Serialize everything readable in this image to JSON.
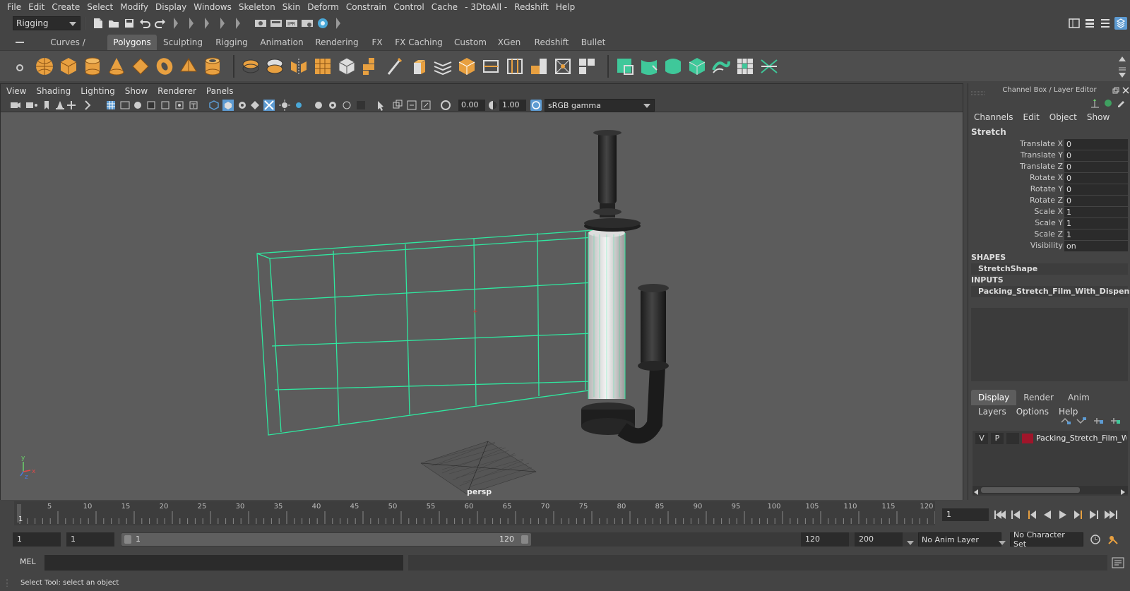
{
  "menubar": {
    "items": [
      "File",
      "Edit",
      "Create",
      "Select",
      "Modify",
      "Display",
      "Windows",
      "Skeleton",
      "Skin",
      "Deform",
      "Constrain",
      "Control",
      "Cache",
      "- 3DtoAll -",
      "Redshift",
      "Help"
    ]
  },
  "statusline": {
    "menuset": "Rigging"
  },
  "shelf": {
    "tabs": [
      "Curves / Surfaces",
      "Polygons",
      "Sculpting",
      "Rigging",
      "Animation",
      "Rendering",
      "FX",
      "FX Caching",
      "Custom",
      "XGen",
      "Redshift",
      "Bullet"
    ],
    "active_tab": "Polygons"
  },
  "viewport": {
    "menu": [
      "View",
      "Shading",
      "Lighting",
      "Show",
      "Renderer",
      "Panels"
    ],
    "exposure": "0.00",
    "gamma": "1.00",
    "color_space": "sRGB gamma",
    "camera_label": "persp",
    "axis_labels": {
      "x": "x",
      "y": "y",
      "z": "z"
    }
  },
  "channelbox": {
    "title": "Channel Box / Layer Editor",
    "menu": [
      "Channels",
      "Edit",
      "Object",
      "Show"
    ],
    "object_name": "Stretch",
    "attributes": [
      {
        "label": "Translate X",
        "value": "0"
      },
      {
        "label": "Translate Y",
        "value": "0"
      },
      {
        "label": "Translate Z",
        "value": "0"
      },
      {
        "label": "Rotate X",
        "value": "0"
      },
      {
        "label": "Rotate Y",
        "value": "0"
      },
      {
        "label": "Rotate Z",
        "value": "0"
      },
      {
        "label": "Scale X",
        "value": "1"
      },
      {
        "label": "Scale Y",
        "value": "1"
      },
      {
        "label": "Scale Z",
        "value": "1"
      },
      {
        "label": "Visibility",
        "value": "on"
      }
    ],
    "shapes_header": "SHAPES",
    "shape_name": "StretchShape",
    "inputs_header": "INPUTS",
    "input_name": "Packing_Stretch_Film_With_Dispenser"
  },
  "layer_editor": {
    "tabs": [
      "Display",
      "Render",
      "Anim"
    ],
    "active_tab": "Display",
    "menu": [
      "Layers",
      "Options",
      "Help"
    ],
    "layer": {
      "v": "V",
      "p": "P",
      "name": "Packing_Stretch_Film_Wi",
      "color": "#a0152a"
    }
  },
  "timeline": {
    "ticks": [
      "5",
      "10",
      "15",
      "20",
      "25",
      "30",
      "35",
      "40",
      "45",
      "50",
      "55",
      "60",
      "65",
      "70",
      "75",
      "80",
      "85",
      "90",
      "95",
      "100",
      "105",
      "110",
      "115",
      "120"
    ],
    "current_frame_marker": "1",
    "current_frame": "1"
  },
  "range": {
    "start": "1",
    "playback_start": "1",
    "slider_start": "1",
    "slider_end": "120",
    "playback_end": "120",
    "end": "200",
    "anim_layer": "No Anim Layer",
    "character_set": "No Character Set"
  },
  "cmdline": {
    "label": "MEL"
  },
  "helpline": {
    "text": "Select Tool: select an object"
  },
  "colors": {
    "wireframe": "#2fe8a0",
    "accent": "#5d9bd2",
    "shelf_orange": "#e8a040",
    "shelf_green": "#3fc89a"
  }
}
